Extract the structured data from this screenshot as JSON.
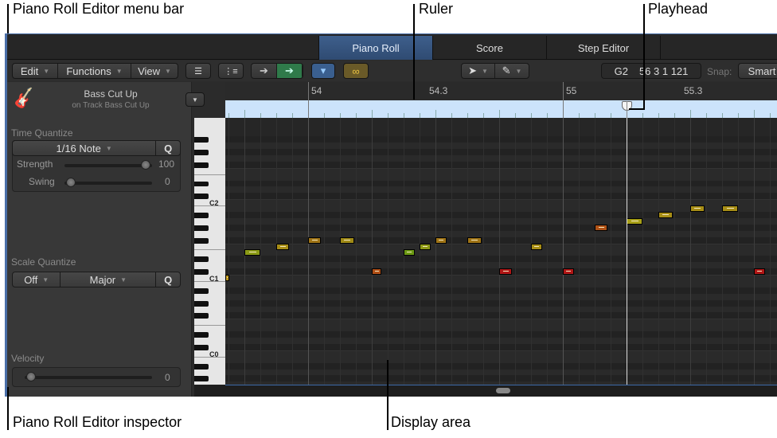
{
  "callouts": {
    "menu_bar": "Piano Roll Editor menu bar",
    "ruler": "Ruler",
    "playhead": "Playhead",
    "inspector": "Piano Roll Editor inspector",
    "display_area": "Display area"
  },
  "tabs": [
    {
      "label": "Piano Roll",
      "active": true
    },
    {
      "label": "Score",
      "active": false
    },
    {
      "label": "Step Editor",
      "active": false
    }
  ],
  "menu": {
    "edit": "Edit",
    "functions": "Functions",
    "view": "View"
  },
  "toolbar": {
    "note_name": "G2",
    "position": "56 3 1 121",
    "snap_label": "Snap:",
    "snap_value": "Smart"
  },
  "inspector": {
    "region_name": "Bass Cut Up",
    "track_name": "on Track Bass Cut Up",
    "time_quantize": {
      "title": "Time Quantize",
      "value": "1/16 Note",
      "q": "Q",
      "strength_label": "Strength",
      "strength": 100,
      "swing_label": "Swing",
      "swing": 0
    },
    "scale_quantize": {
      "title": "Scale Quantize",
      "root": "Off",
      "scale": "Major",
      "q": "Q"
    },
    "velocity": {
      "title": "Velocity",
      "value": 0
    }
  },
  "keyboard": {
    "labels": [
      "C2",
      "C1",
      "C0"
    ]
  },
  "ruler": {
    "marks": [
      "54",
      "54.3",
      "55",
      "55.3"
    ]
  },
  "playhead_beat": 5,
  "notes": [
    {
      "start": -1.3,
      "len": 0.06,
      "pitch": 0,
      "color": "#c29a1a"
    },
    {
      "start": -1.0,
      "len": 0.25,
      "pitch": 4,
      "color": "#8a9a16"
    },
    {
      "start": -0.5,
      "len": 0.2,
      "pitch": 5,
      "color": "#a88e16"
    },
    {
      "start": 0.0,
      "len": 0.2,
      "pitch": 6,
      "color": "#a07416"
    },
    {
      "start": 0.5,
      "len": 0.22,
      "pitch": 6,
      "color": "#a08a16"
    },
    {
      "start": 1.0,
      "len": 0.15,
      "pitch": 1,
      "color": "#b04e16"
    },
    {
      "start": 1.5,
      "len": 0.17,
      "pitch": 4,
      "color": "#6c9a14"
    },
    {
      "start": 1.75,
      "len": 0.17,
      "pitch": 5,
      "color": "#8e9a16"
    },
    {
      "start": 2.0,
      "len": 0.17,
      "pitch": 6,
      "color": "#a07416"
    },
    {
      "start": 2.5,
      "len": 0.22,
      "pitch": 6,
      "color": "#a07416"
    },
    {
      "start": 3.0,
      "len": 0.2,
      "pitch": 1,
      "color": "#b01616"
    },
    {
      "start": 3.5,
      "len": 0.17,
      "pitch": 5,
      "color": "#a88e16"
    },
    {
      "start": 4.0,
      "len": 0.17,
      "pitch": 1,
      "color": "#b01616"
    },
    {
      "start": 4.5,
      "len": 0.2,
      "pitch": 8,
      "color": "#b05216"
    },
    {
      "start": 5.0,
      "len": 0.25,
      "pitch": 9,
      "color": "#a8a018"
    },
    {
      "start": 5.5,
      "len": 0.22,
      "pitch": 10,
      "color": "#a88e16"
    },
    {
      "start": 6.0,
      "len": 0.22,
      "pitch": 11,
      "color": "#a88e16"
    },
    {
      "start": 6.5,
      "len": 0.25,
      "pitch": 11,
      "color": "#a88e16"
    },
    {
      "start": 7.0,
      "len": 0.17,
      "pitch": 1,
      "color": "#b01616"
    }
  ]
}
